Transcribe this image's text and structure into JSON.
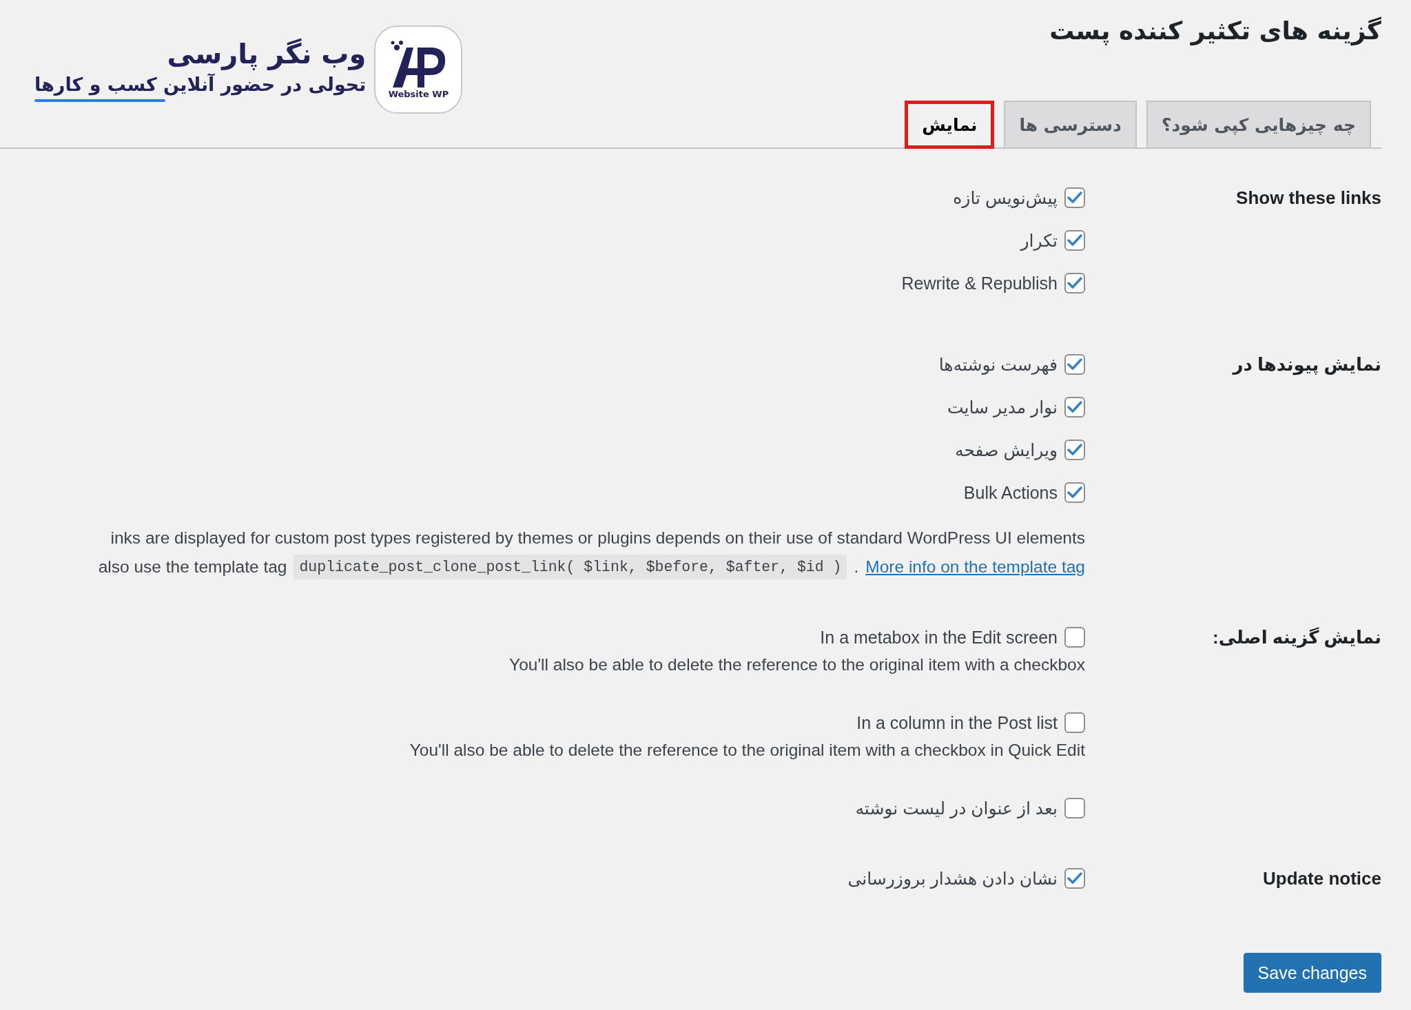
{
  "page_title": "گزینه های تکثیر کننده پست",
  "logo": {
    "name": "وب نگر پارسی",
    "tagline": "تحولی در حضور آنلاین کسب و کارها",
    "badge_text": "Website WP"
  },
  "tabs": [
    {
      "label": "چه چیزهایی کپی شود؟",
      "selected": false,
      "highlighted": false
    },
    {
      "label": "دسترسی ها",
      "selected": false,
      "highlighted": false
    },
    {
      "label": "نمایش",
      "selected": true,
      "highlighted": true
    }
  ],
  "sections": [
    {
      "heading": "Show these links",
      "options": [
        {
          "label": "پیش‌نویس تازه",
          "checked": true
        },
        {
          "label": "تکرار",
          "checked": true
        },
        {
          "label": "Rewrite & Republish",
          "checked": true
        }
      ]
    },
    {
      "heading": "نمایش پیوندها در",
      "options": [
        {
          "label": "فهرست نوشته‌ها",
          "checked": true
        },
        {
          "label": "نوار مدیر سایت",
          "checked": true
        },
        {
          "label": "ویرایش صفحه",
          "checked": true
        },
        {
          "label": "Bulk Actions",
          "checked": true
        }
      ],
      "note": {
        "line_1": "inks are displayed for custom post types registered by themes or plugins depends on their use of standard WordPress UI elements",
        "line_2": "also use the template tag",
        "code": "duplicate_post_clone_post_link( $link, $before, $after, $id )",
        "separator": ".",
        "link": "More info on the template tag"
      }
    },
    {
      "heading": "نمایش گزینه اصلی:",
      "options": [
        {
          "label": "In a metabox in the Edit screen",
          "checked": false,
          "description": "You'll also be able to delete the reference to the original item with a checkbox"
        },
        {
          "label": "In a column in the Post list",
          "checked": false,
          "description": "You'll also be able to delete the reference to the original item with a checkbox in Quick Edit"
        },
        {
          "label": "بعد از عنوان در لیست نوشته",
          "checked": false
        }
      ]
    },
    {
      "heading": "Update notice",
      "options": [
        {
          "label": "نشان دادن هشدار بروزرسانی",
          "checked": true
        }
      ]
    }
  ],
  "save_button": "Save changes"
}
